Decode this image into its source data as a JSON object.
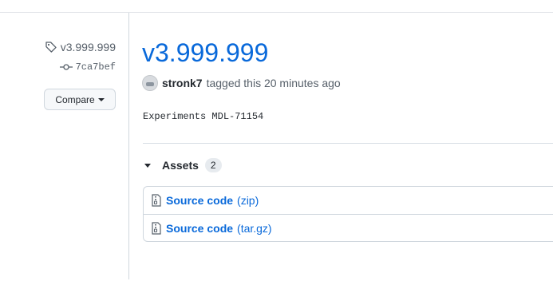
{
  "sidebar": {
    "tag": "v3.999.999",
    "commit": "7ca7bef",
    "compare_label": "Compare"
  },
  "release": {
    "title": "v3.999.999",
    "author": "stronk7",
    "tagged_text": "tagged this 20 minutes ago",
    "notes": "Experiments MDL-71154"
  },
  "assets": {
    "label": "Assets",
    "count": "2",
    "items": [
      {
        "name": "Source code",
        "ext": "(zip)"
      },
      {
        "name": "Source code",
        "ext": "(tar.gz)"
      }
    ]
  },
  "colors": {
    "link": "#0969da",
    "muted": "#57606a",
    "border": "#d0d7de"
  },
  "icons": {
    "tag": "tag-icon",
    "commit": "git-commit-icon",
    "file": "file-zip-icon",
    "caret": "triangle-down-icon"
  }
}
